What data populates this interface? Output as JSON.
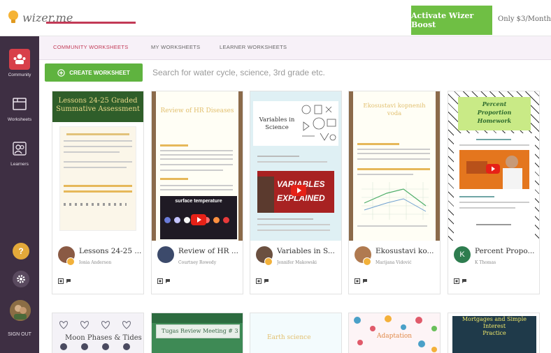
{
  "app": {
    "logo_text": "wizer.me"
  },
  "header": {
    "boost_label": "Activate Wizer Boost",
    "price_text": "Only $3/Month!"
  },
  "sidebar": {
    "items": [
      {
        "label": "Community"
      },
      {
        "label": "Worksheets"
      },
      {
        "label": "Learners"
      }
    ],
    "help_label": "?",
    "sign_out_label": "SIGN OUT"
  },
  "tabs": [
    {
      "label": "COMMUNITY WORKSHEETS"
    },
    {
      "label": "MY WORKSHEETS"
    },
    {
      "label": "LEARNER WORKSHEETS"
    }
  ],
  "toolbar": {
    "create_label": "CREATE WORKSHEET"
  },
  "search": {
    "placeholder": "Search for water cycle, science, 3rd grade etc."
  },
  "cards": [
    {
      "title": "Lessons 24-25 ...",
      "author": "Ionia Anderson",
      "thumb_title": "Lessons 24-25 Graded Summative Assessment",
      "avatar_color": "#8a5a44"
    },
    {
      "title": "Review of HR ...",
      "author": "Courtney Rowedy",
      "thumb_title": "Review of HR Diseases",
      "thumb_sub": "surface temperature",
      "avatar_color": "#3c4a6b"
    },
    {
      "title": "Variables in S...",
      "author": "Jennifer Makowski",
      "thumb_title": "Variables in Science",
      "thumb_sub_a": "VARIABLES",
      "thumb_sub_b": "EXPLAINED",
      "avatar_color": "#6b5040"
    },
    {
      "title": "Ekosustavi ko...",
      "author": "Marijana Vidović",
      "thumb_title": "Ekosustavi kopnenih voda",
      "avatar_color": "#b07a50"
    },
    {
      "title": "Percent Propo...",
      "author": "K Thomas",
      "avatar_letter": "K",
      "thumb_title_a": "Percent",
      "thumb_title_b": "Proportion",
      "thumb_title_c": "Homework",
      "avatar_color": "#2e7d4f"
    }
  ],
  "row2": [
    {
      "title": "Moon Phases & Tides"
    },
    {
      "title": "Tugas Review Meeting # 3"
    },
    {
      "title": "Earth science"
    },
    {
      "title": "Adaptation"
    },
    {
      "title_a": "Mortgages and Simple",
      "title_b": "Interest",
      "title_c": "Practice"
    }
  ],
  "colors": {
    "accent": "#c23a56",
    "green": "#5fb33f",
    "sidebar": "#3e2f43"
  }
}
